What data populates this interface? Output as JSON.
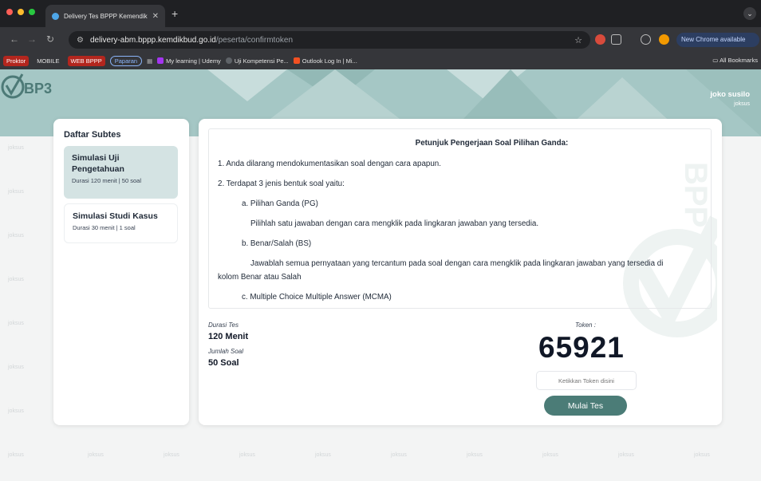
{
  "browser": {
    "tab_title": "Delivery Tes BPPP Kemendikb",
    "url_host": "delivery-abm.bppp.kemdikbud.go.id",
    "url_path": "/peserta/confirmtoken",
    "new_chrome_label": "New Chrome available",
    "bookmarks": [
      "Proktor",
      "MOBILE",
      "WEB BPPP",
      "Paparan",
      "My learning | Udemy",
      "Uji Kompetensi Pe...",
      "Outlook Log In | Mi..."
    ],
    "all_bookmarks_label": "All Bookmarks"
  },
  "header": {
    "logo_text": "BP3",
    "user_name": "joko susilo",
    "user_id": "joksus"
  },
  "watermark_text": "joksus",
  "sidebar": {
    "title": "Daftar Subtes",
    "items": [
      {
        "title": "Simulasi Uji Pengetahuan",
        "detail": "Durasi 120 menit | 50 soal"
      },
      {
        "title": "Simulasi Studi Kasus",
        "detail": "Durasi 30 menit | 1 soal"
      }
    ]
  },
  "instructions": {
    "heading": "Petunjuk Pengerjaan Soal Pilihan Ganda:",
    "lines": [
      "1. Anda dilarang mendokumentasikan soal dengan cara apapun.",
      "2. Terdapat 3 jenis bentuk soal yaitu:",
      "a. Pilihan Ganda (PG)",
      "Pilihlah satu jawaban dengan cara mengklik pada lingkaran jawaban yang tersedia.",
      "b. Benar/Salah (BS)",
      "Jawablah semua pernyataan yang tercantum pada soal dengan cara mengklik pada lingkaran jawaban yang tersedia di",
      "kolom Benar atau Salah",
      "c. Multiple Choice Multiple Answer (MCMA)"
    ]
  },
  "test_info": {
    "duration_label": "Durasi Tes",
    "duration_value": "120 Menit",
    "count_label": "Jumlah Soal",
    "count_value": "50 Soal"
  },
  "token": {
    "label": "Token :",
    "value": "65921",
    "input_placeholder": "Ketikkan Token disini",
    "start_button": "Mulai Tes"
  }
}
